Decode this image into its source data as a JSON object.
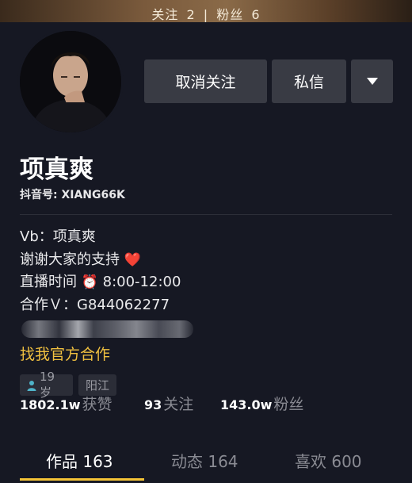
{
  "cover": {
    "following_label": "关注",
    "following_count": "2",
    "separator": "|",
    "fans_label": "粉丝",
    "fans_count": "6"
  },
  "actions": {
    "unfollow_label": "取消关注",
    "message_label": "私信"
  },
  "profile": {
    "name": "项真爽",
    "douyin_id": "抖音号: XIANG66K"
  },
  "bio": {
    "line1": "Vb：项真爽",
    "line2_text": "谢谢大家的支持",
    "line2_emoji": "❤️",
    "line3_prefix": "直播时间",
    "line3_emoji": "⏰",
    "line3_time": "8:00-12:00",
    "line4": "合作Ｖ：G844062277"
  },
  "official_link": "找我官方合作",
  "tags": {
    "age": "19岁",
    "location": "阳江"
  },
  "stats": {
    "likes_value": "1802.1w",
    "likes_label": "获赞",
    "following_value": "93",
    "following_label": "关注",
    "fans_value": "143.0w",
    "fans_label": "粉丝"
  },
  "tabs": [
    {
      "label": "作品 163"
    },
    {
      "label": "动态 164"
    },
    {
      "label": "喜欢 600"
    }
  ],
  "colors": {
    "background": "#161823",
    "button": "#393b44",
    "accent_yellow": "#f5c437",
    "link_yellow": "#f0c040",
    "muted_text": "#8a8b93"
  },
  "icons": {
    "more": "triangle-down",
    "age_tag": "person-icon"
  }
}
